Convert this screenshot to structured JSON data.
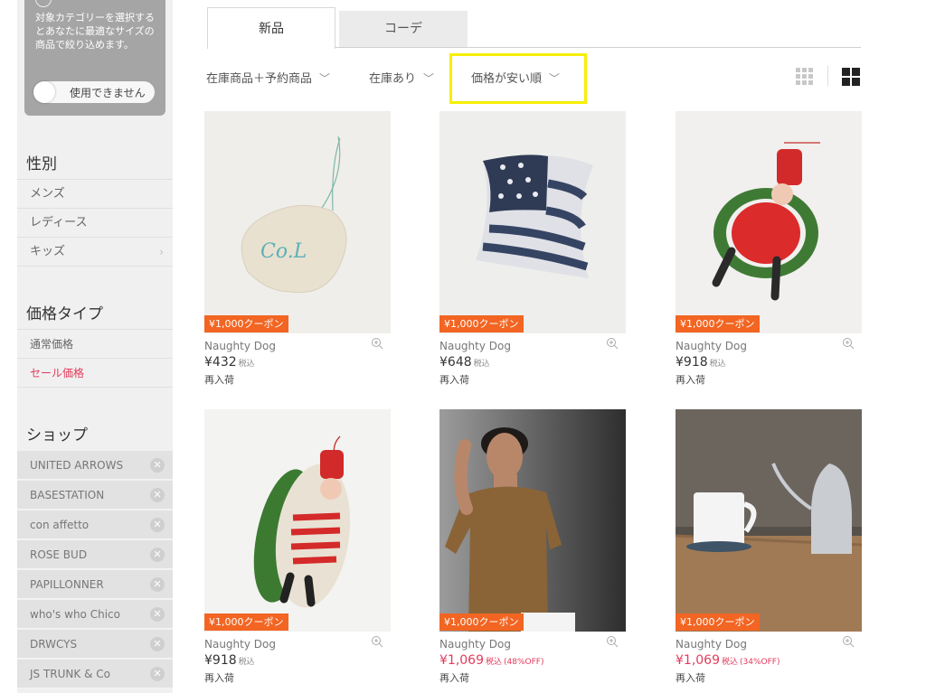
{
  "sidebar": {
    "promo_text": "対象カテゴリーを選択するとあなたに最適なサイズの商品で絞り込めます。",
    "toggle_label": "使用できません",
    "gender_title": "性別",
    "gender_items": [
      "メンズ",
      "レディース",
      "キッズ"
    ],
    "price_type_title": "価格タイプ",
    "price_type_items": [
      "通常価格",
      "セール価格"
    ],
    "shop_title": "ショップ",
    "shops": [
      "UNITED ARROWS",
      "BASESTATION",
      "con affetto",
      "ROSE BUD",
      "PAPILLONNER",
      "who's who Chico",
      "DRWCYS",
      "JS TRUNK & Co"
    ],
    "remove_symbol": "✕",
    "chevron": "›"
  },
  "tabs": [
    "新品",
    "コーデ"
  ],
  "filters": {
    "stock_type": "在庫商品＋予約商品",
    "availability": "在庫あり",
    "sort": "価格が安い順",
    "chevron": "﹀"
  },
  "colors": {
    "coupon": "#f26522",
    "sale": "#e23b5b",
    "highlight": "#f6ef05"
  },
  "products": [
    {
      "coupon": "¥1,000クーポン",
      "brand": "Naughty Dog",
      "price": "¥432",
      "tax": "税込",
      "discount": "",
      "note": "再入荷",
      "image": "felt-shell-ornament"
    },
    {
      "coupon": "¥1,000クーポン",
      "brand": "Naughty Dog",
      "price": "¥648",
      "tax": "税込",
      "discount": "",
      "note": "再入荷",
      "image": "flag-fin-ornament"
    },
    {
      "coupon": "¥1,000クーポン",
      "brand": "Naughty Dog",
      "price": "¥918",
      "tax": "税込",
      "discount": "",
      "note": "再入荷",
      "image": "santa-wreath-ornament"
    },
    {
      "coupon": "¥1,000クーポン",
      "brand": "Naughty Dog",
      "price": "¥918",
      "tax": "税込",
      "discount": "",
      "note": "再入荷",
      "image": "santa-surfboard-ornament"
    },
    {
      "coupon": "¥1,000クーポン",
      "brand": "Naughty Dog",
      "price": "¥1,069",
      "tax": "税込",
      "discount": "(48%OFF)",
      "note": "再入荷",
      "image": "model-brown-tshirt"
    },
    {
      "coupon": "¥1,000クーポン",
      "brand": "Naughty Dog",
      "price": "¥1,069",
      "tax": "税込",
      "discount": "(34%OFF)",
      "note": "再入荷",
      "image": "mug-kettle-table"
    }
  ]
}
